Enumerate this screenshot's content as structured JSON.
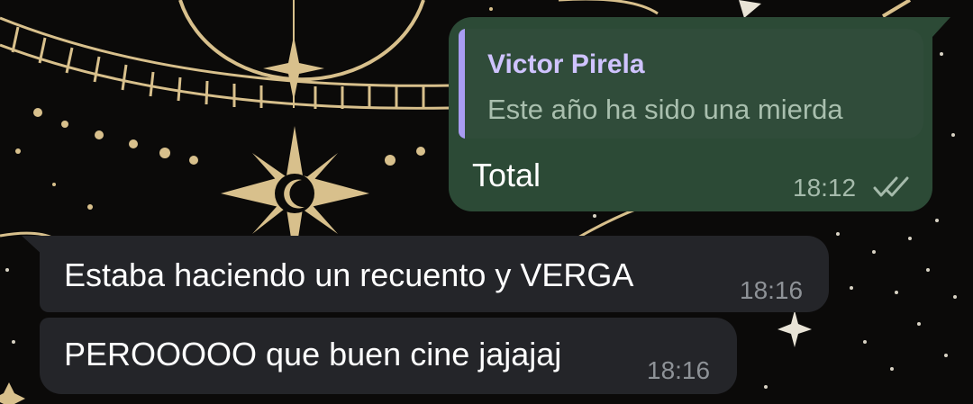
{
  "messages": [
    {
      "direction": "outgoing",
      "reply": {
        "name": "Victor Pirela",
        "text": "Este año ha sido una mierda"
      },
      "text": "Total",
      "time": "18:12",
      "status_icon": "double-check-icon"
    },
    {
      "direction": "incoming",
      "text": "Estaba haciendo un recuento y VERGA",
      "time": "18:16"
    },
    {
      "direction": "incoming",
      "text": "PEROOOOO que buen cine jajajaj",
      "time": "18:16"
    }
  ],
  "colors": {
    "background": "#0b0a09",
    "wallpaper_gold": "#d8c08c",
    "outgoing_bubble": "#2c4a36",
    "incoming_bubble": "#242529",
    "reply_accent": "#a99cf2",
    "reply_name": "#cfc3ff"
  }
}
